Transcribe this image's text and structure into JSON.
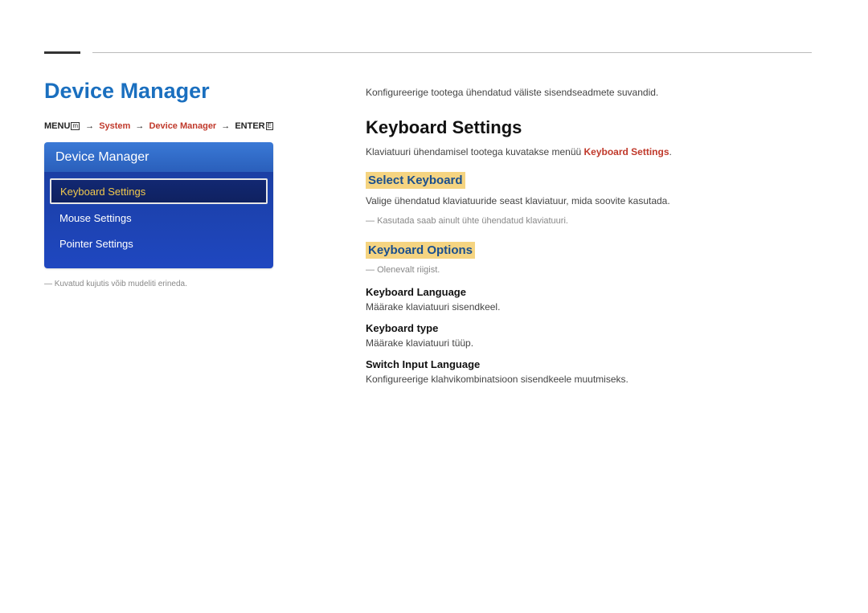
{
  "left": {
    "title": "Device Manager",
    "breadcrumb": {
      "menu": "MENU",
      "menu_icon": "m",
      "system": "System",
      "device_manager": "Device Manager",
      "enter": "ENTER",
      "enter_icon": "E"
    },
    "panel": {
      "header": "Device Manager",
      "items": [
        {
          "label": "Keyboard Settings",
          "selected": true
        },
        {
          "label": "Mouse Settings",
          "selected": false
        },
        {
          "label": "Pointer Settings",
          "selected": false
        }
      ]
    },
    "caption": "Kuvatud kujutis võib mudeliti erineda."
  },
  "right": {
    "intro": "Konfigureerige tootega ühendatud väliste sisendseadmete suvandid.",
    "h2": "Keyboard Settings",
    "kb_connect_pre": "Klaviatuuri ühendamisel tootega kuvatakse menüü ",
    "kb_connect_hl": "Keyboard Settings",
    "kb_connect_post": ".",
    "select_keyboard": {
      "heading": "Select Keyboard",
      "desc": "Valige ühendatud klaviatuuride seast klaviatuur, mida soovite kasutada.",
      "note": "Kasutada saab ainult ühte ühendatud klaviatuuri."
    },
    "keyboard_options": {
      "heading": "Keyboard Options",
      "note": "Olenevalt riigist.",
      "lang": {
        "h": "Keyboard Language",
        "d": "Määrake klaviatuuri sisendkeel."
      },
      "type": {
        "h": "Keyboard type",
        "d": "Määrake klaviatuuri tüüp."
      },
      "switch": {
        "h": "Switch Input Language",
        "d": "Konfigureerige klahvikombinatsioon sisendkeele muutmiseks."
      }
    }
  }
}
